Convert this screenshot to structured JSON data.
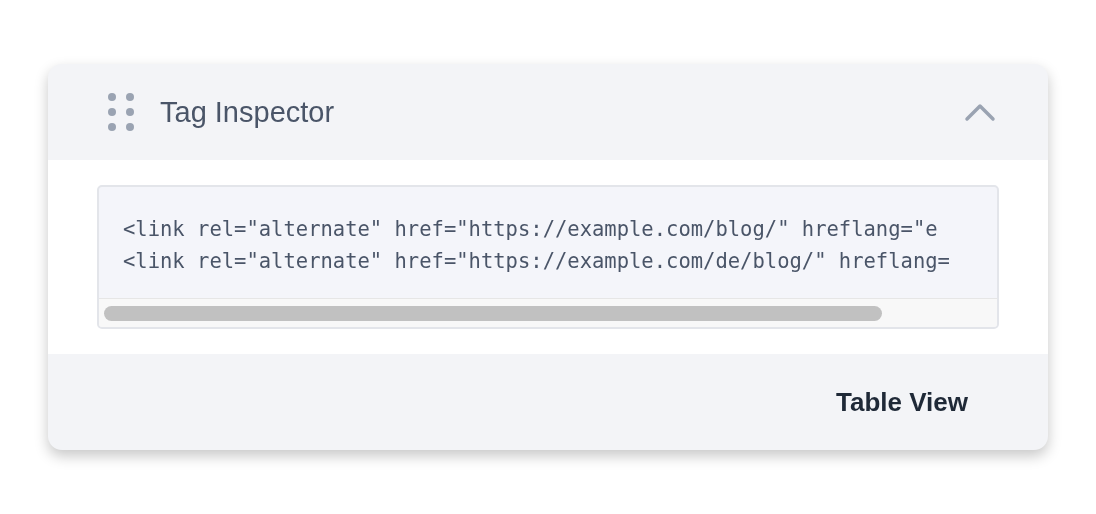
{
  "panel": {
    "title": "Tag Inspector",
    "expanded": true
  },
  "code_lines": [
    "<link rel=\"alternate\" href=\"https://example.com/blog/\" hreflang=\"e",
    "<link rel=\"alternate\" href=\"https://example.com/de/blog/\" hreflang="
  ],
  "footer": {
    "button": "Table View"
  }
}
